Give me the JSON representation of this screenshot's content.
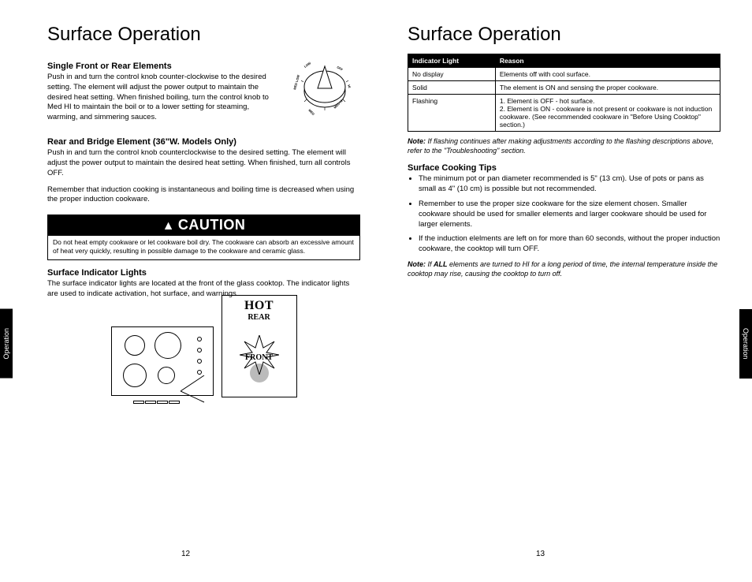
{
  "left": {
    "title": "Surface Operation",
    "s1_heading": "Single Front or Rear Elements",
    "s1_body": "Push in and turn the control knob counter-clockwise to the desired setting. The element will adjust the power output to maintain the desired heat setting. When finished boiling, turn the control knob to Med HI to maintain the boil or to a lower setting for steaming, warming, and simmering sauces.",
    "s2_heading": "Rear and Bridge Element (36\"W. Models Only)",
    "s2_body": "Push in and turn the control knob counterclockwise to the desired setting. The element will adjust the power output to maintain the desired heat setting. When finished, turn all controls OFF.",
    "s2_body2": "Remember that induction cooking is instantaneous and boiling time is decreased when using the proper induction cookware.",
    "caution_label": "CAUTION",
    "caution_text": "Do not heat empty cookware or let cookware boil dry. The cookware can absorb an excessive amount of heat very quickly, resulting in possible damage to the cookware and ceramic glass.",
    "s3_heading": "Surface Indicator Lights",
    "s3_body": "The surface indicator lights are located at the front of the glass cooktop. The indicator lights are used to indicate activation, hot surface, and warnings.",
    "diagram_hot": "HOT",
    "diagram_rear": "REAR",
    "diagram_front": "FRONT",
    "knob_labels": {
      "off": "OFF",
      "hi": "HI",
      "medhi": "MED HI",
      "med": "MED",
      "medlow": "MED LOW",
      "low": "LOW"
    }
  },
  "right": {
    "title": "Surface Operation",
    "table": {
      "col1": "Indicator Light",
      "col2": "Reason",
      "rows": [
        {
          "c1": "No display",
          "c2": "Elements off with cool surface."
        },
        {
          "c1": "Solid",
          "c2": "The element is ON and sensing the proper cookware."
        },
        {
          "c1": "Flashing",
          "c2": "1. Element is OFF - hot surface.\n2. Element is ON - cookware is not present or cookware is not induction cookware. (See recommended cookware in \"Before Using Cooktop\" section.)"
        }
      ]
    },
    "note1_lead": "Note:",
    "note1_body": " If flashing continues after making adjustments according to the flashing descriptions above, refer to the \"Troubleshooting\" section.",
    "tips_heading": "Surface Cooking Tips",
    "tips": [
      "The minimum pot or pan diameter recommended is 5\" (13 cm). Use of pots or pans as small as 4\" (10 cm) is possible but not recommended.",
      "Remember to use the proper size cookware for the size element chosen. Smaller cookware should be used for smaller elements and larger cookware should be used for larger elements.",
      "If the induction elelments are left on for more than 60 seconds, without the proper induction cookware, the cooktop will turn OFF."
    ],
    "note2_lead": "Note:",
    "note2_pre": " If ",
    "note2_bold": "ALL",
    "note2_body": " elements are turned to HI for a long period of time, the internal temperature inside the cooktop may rise, causing the cooktop to turn off."
  },
  "side_tab_left": "Operation",
  "side_tab_right": "Operation",
  "page_left": "12",
  "page_right": "13"
}
